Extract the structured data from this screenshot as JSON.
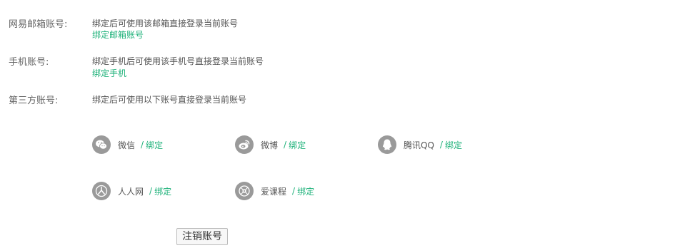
{
  "email": {
    "label": "网易邮箱账号:",
    "desc": "绑定后可使用该邮箱直接登录当前账号",
    "link": "绑定邮箱账号"
  },
  "phone": {
    "label": "手机账号:",
    "desc": "绑定手机后可使用该手机号直接登录当前账号",
    "link": "绑定手机"
  },
  "third_party": {
    "label": "第三方账号:",
    "desc": "绑定后可使用以下账号直接登录当前账号",
    "separator": "/",
    "items": [
      {
        "name": "微信",
        "icon": "wechat-icon",
        "action": "绑定"
      },
      {
        "name": "微博",
        "icon": "weibo-icon",
        "action": "绑定"
      },
      {
        "name": "腾讯QQ",
        "icon": "qq-icon",
        "action": "绑定"
      },
      {
        "name": "人人网",
        "icon": "renren-icon",
        "action": "绑定"
      },
      {
        "name": "爱课程",
        "icon": "icourse-icon",
        "action": "绑定"
      }
    ]
  },
  "cancel_account_label": "注销账号",
  "colors": {
    "link": "#1fb27a",
    "icon_bg": "#9a9a9a",
    "text": "#555555"
  }
}
